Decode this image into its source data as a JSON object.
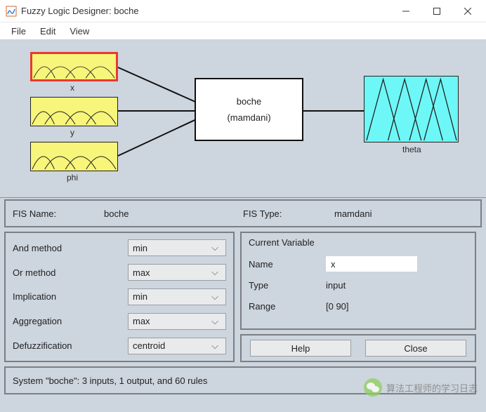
{
  "window": {
    "title": "Fuzzy Logic Designer: boche"
  },
  "menu": {
    "file": "File",
    "edit": "Edit",
    "view": "View"
  },
  "diagram": {
    "inputs": [
      {
        "label": "x",
        "selected": true
      },
      {
        "label": "y",
        "selected": false
      },
      {
        "label": "phi",
        "selected": false
      }
    ],
    "center": {
      "name": "boche",
      "type": "(mamdani)"
    },
    "output": {
      "label": "theta"
    }
  },
  "fis": {
    "name_label": "FIS Name:",
    "name_value": "boche",
    "type_label": "FIS Type:",
    "type_value": "mamdani"
  },
  "methods": {
    "and_label": "And method",
    "and_value": "min",
    "or_label": "Or method",
    "or_value": "max",
    "imp_label": "Implication",
    "imp_value": "min",
    "agg_label": "Aggregation",
    "agg_value": "max",
    "defuzz_label": "Defuzzification",
    "defuzz_value": "centroid"
  },
  "currvar": {
    "heading": "Current Variable",
    "name_label": "Name",
    "name_value": "x",
    "type_label": "Type",
    "type_value": "input",
    "range_label": "Range",
    "range_value": "[0 90]"
  },
  "buttons": {
    "help": "Help",
    "close": "Close"
  },
  "status": {
    "text": "System \"boche\": 3 inputs, 1 output, and 60 rules"
  },
  "watermark": {
    "text": "算法工程师的学习日志"
  }
}
